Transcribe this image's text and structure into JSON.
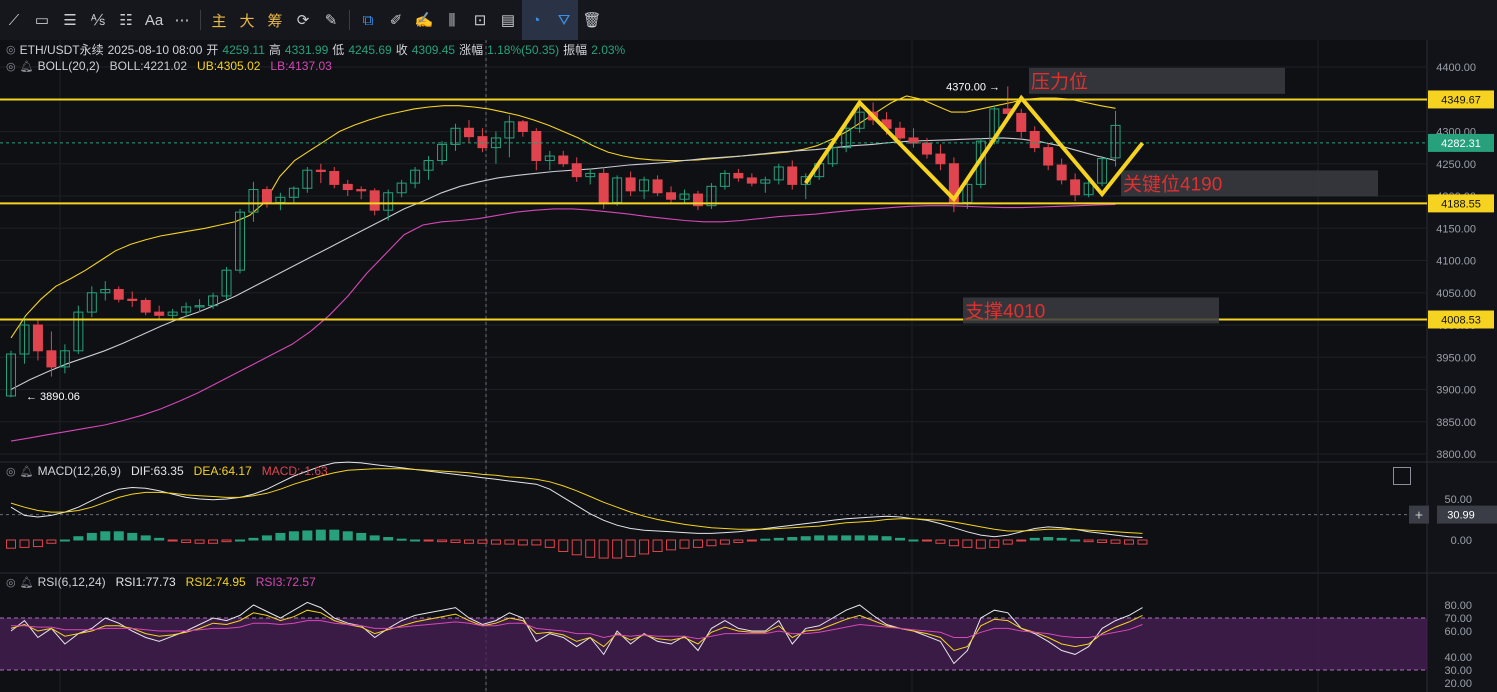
{
  "toolbar": {
    "items": [
      {
        "name": "line-tool-icon",
        "glyph": "⟋"
      },
      {
        "name": "rectangle-tool-icon",
        "glyph": "▭"
      },
      {
        "name": "parallel-lines-icon",
        "glyph": "☰"
      },
      {
        "name": "fib-tool-icon",
        "glyph": "⅍"
      },
      {
        "name": "fib-levels-icon",
        "glyph": "☷"
      },
      {
        "name": "text-tool-icon",
        "glyph": "Aa"
      },
      {
        "name": "more-icon",
        "glyph": "⋯"
      }
    ],
    "cn_items": [
      "主",
      "大",
      "筹"
    ],
    "tools2": [
      {
        "name": "replay-icon",
        "glyph": "⟳"
      },
      {
        "name": "draw-icon",
        "glyph": "✎"
      }
    ],
    "tools3": [
      {
        "name": "copy-icon",
        "glyph": "⧉",
        "blue": true
      },
      {
        "name": "ruler-icon",
        "glyph": "✐"
      },
      {
        "name": "brush-icon",
        "glyph": "✍"
      },
      {
        "name": "candle-type-icon",
        "glyph": "⫼"
      },
      {
        "name": "lock-icon",
        "glyph": "⊡"
      },
      {
        "name": "template-icon",
        "glyph": "▤"
      },
      {
        "name": "magnet-icon",
        "glyph": "◔",
        "blue": true,
        "active": true
      },
      {
        "name": "filter-icon",
        "glyph": "⛛",
        "blue": true,
        "active": true
      },
      {
        "name": "trash-icon",
        "glyph": "🗑"
      }
    ]
  },
  "main_legend": {
    "symbol": "ETH/USDT永续",
    "datetime": "2025-08-10 08:00",
    "open_label": "开",
    "open": "4259.11",
    "high_label": "高",
    "high": "4331.99",
    "low_label": "低",
    "low": "4245.69",
    "close_label": "收",
    "close": "4309.45",
    "change_label": "涨幅",
    "change": "1.18%(50.35)",
    "amp_label": "振幅",
    "amp": "2.03%"
  },
  "boll_legend": {
    "name": "BOLL(20,2)",
    "boll": "BOLL:4221.02",
    "ub": "UB:4305.02",
    "lb": "LB:4137.03"
  },
  "macd_legend": {
    "name": "MACD(12,26,9)",
    "dif": "DIF:63.35",
    "dea": "DEA:64.17",
    "macd": "MACD:-1.63"
  },
  "rsi_legend": {
    "name": "RSI(6,12,24)",
    "rsi1": "RSI1:77.73",
    "rsi2": "RSI2:74.95",
    "rsi3": "RSI3:72.57"
  },
  "colors": {
    "up": "#26a17b",
    "down": "#e0444e",
    "mid": "#c9cbd1",
    "upper": "#f5d320",
    "lower": "#d548b6",
    "rsi1": "#e6e6ea",
    "rsi2": "#f5d320",
    "rsi3": "#d548b6",
    "level": "#f5d320"
  },
  "chart_data": {
    "type": "candlestick",
    "price_axis": {
      "min": 3800,
      "max": 4400,
      "ticks": [
        "3800.00",
        "3850.00",
        "3900.00",
        "3950.00",
        "4000.00",
        "4050.00",
        "4100.00",
        "4150.00",
        "4200.00",
        "4250.00",
        "4300.00",
        "4350.00",
        "4400.00"
      ]
    },
    "levels": [
      {
        "value": 4349.67,
        "label": "4349.67"
      },
      {
        "value": 4188.55,
        "label": "4188.55"
      },
      {
        "value": 4008.53,
        "label": "4008.53"
      }
    ],
    "current_price": {
      "value": 4282.31,
      "label": "4282.31"
    },
    "annotations": [
      {
        "text": "压力位",
        "price": 4377
      },
      {
        "text": "关键位4190",
        "price": 4218
      },
      {
        "text": "支撑4010",
        "price": 4021
      }
    ],
    "high_marker": {
      "value": 4370.0,
      "label": "4370.00 →"
    },
    "low_marker": {
      "value": 3890.06,
      "label": "← 3890.06"
    },
    "candles": [
      [
        3890,
        3960,
        3888,
        3955
      ],
      [
        3955,
        4012,
        3940,
        4000
      ],
      [
        4000,
        4008,
        3945,
        3960
      ],
      [
        3960,
        3990,
        3920,
        3935
      ],
      [
        3935,
        3970,
        3925,
        3960
      ],
      [
        3960,
        4030,
        3955,
        4020
      ],
      [
        4020,
        4060,
        4012,
        4050
      ],
      [
        4050,
        4068,
        4038,
        4055
      ],
      [
        4055,
        4060,
        4035,
        4040
      ],
      [
        4040,
        4052,
        4028,
        4038
      ],
      [
        4038,
        4042,
        4015,
        4020
      ],
      [
        4020,
        4030,
        4010,
        4015
      ],
      [
        4015,
        4025,
        4008,
        4020
      ],
      [
        4020,
        4035,
        4012,
        4028
      ],
      [
        4028,
        4040,
        4020,
        4030
      ],
      [
        4030,
        4050,
        4025,
        4045
      ],
      [
        4045,
        4090,
        4040,
        4085
      ],
      [
        4085,
        4180,
        4080,
        4175
      ],
      [
        4175,
        4222,
        4160,
        4210
      ],
      [
        4210,
        4215,
        4182,
        4190
      ],
      [
        4190,
        4205,
        4178,
        4198
      ],
      [
        4198,
        4215,
        4190,
        4212
      ],
      [
        4212,
        4245,
        4205,
        4240
      ],
      [
        4240,
        4250,
        4220,
        4238
      ],
      [
        4238,
        4245,
        4212,
        4218
      ],
      [
        4218,
        4225,
        4200,
        4210
      ],
      [
        4210,
        4215,
        4195,
        4208
      ],
      [
        4208,
        4212,
        4170,
        4178
      ],
      [
        4178,
        4210,
        4162,
        4205
      ],
      [
        4205,
        4225,
        4198,
        4220
      ],
      [
        4220,
        4245,
        4212,
        4240
      ],
      [
        4240,
        4262,
        4225,
        4255
      ],
      [
        4255,
        4285,
        4248,
        4280
      ],
      [
        4280,
        4312,
        4270,
        4305
      ],
      [
        4305,
        4318,
        4282,
        4292
      ],
      [
        4292,
        4305,
        4268,
        4275
      ],
      [
        4275,
        4300,
        4250,
        4290
      ],
      [
        4290,
        4325,
        4260,
        4315
      ],
      [
        4315,
        4318,
        4292,
        4300
      ],
      [
        4300,
        4305,
        4240,
        4255
      ],
      [
        4255,
        4270,
        4240,
        4262
      ],
      [
        4262,
        4270,
        4245,
        4250
      ],
      [
        4250,
        4260,
        4222,
        4230
      ],
      [
        4230,
        4242,
        4218,
        4235
      ],
      [
        4235,
        4245,
        4180,
        4190
      ],
      [
        4190,
        4232,
        4185,
        4228
      ],
      [
        4228,
        4238,
        4200,
        4208
      ],
      [
        4208,
        4230,
        4195,
        4225
      ],
      [
        4225,
        4232,
        4200,
        4205
      ],
      [
        4205,
        4215,
        4188,
        4195
      ],
      [
        4195,
        4210,
        4190,
        4203
      ],
      [
        4203,
        4208,
        4178,
        4185
      ],
      [
        4185,
        4220,
        4180,
        4215
      ],
      [
        4215,
        4240,
        4210,
        4235
      ],
      [
        4235,
        4242,
        4222,
        4228
      ],
      [
        4228,
        4235,
        4215,
        4220
      ],
      [
        4220,
        4230,
        4205,
        4225
      ],
      [
        4225,
        4250,
        4218,
        4245
      ],
      [
        4245,
        4255,
        4210,
        4218
      ],
      [
        4218,
        4235,
        4195,
        4230
      ],
      [
        4230,
        4255,
        4225,
        4250
      ],
      [
        4250,
        4282,
        4245,
        4275
      ],
      [
        4275,
        4312,
        4268,
        4305
      ],
      [
        4305,
        4340,
        4298,
        4330
      ],
      [
        4330,
        4345,
        4310,
        4318
      ],
      [
        4318,
        4330,
        4295,
        4305
      ],
      [
        4305,
        4315,
        4280,
        4290
      ],
      [
        4290,
        4305,
        4275,
        4282
      ],
      [
        4282,
        4290,
        4258,
        4265
      ],
      [
        4265,
        4280,
        4240,
        4250
      ],
      [
        4250,
        4260,
        4175,
        4190
      ],
      [
        4190,
        4225,
        4180,
        4218
      ],
      [
        4218,
        4290,
        4212,
        4285
      ],
      [
        4285,
        4340,
        4280,
        4335
      ],
      [
        4335,
        4370,
        4320,
        4328
      ],
      [
        4328,
        4335,
        4290,
        4300
      ],
      [
        4300,
        4308,
        4268,
        4275
      ],
      [
        4275,
        4282,
        4240,
        4248
      ],
      [
        4248,
        4258,
        4218,
        4225
      ],
      [
        4225,
        4235,
        4192,
        4202
      ],
      [
        4202,
        4225,
        4198,
        4220
      ],
      [
        4220,
        4262,
        4215,
        4258
      ],
      [
        4259.11,
        4331.99,
        4245.69,
        4309.45
      ]
    ],
    "boll_upper": [
      3980,
      4015,
      4040,
      4060,
      4072,
      4085,
      4100,
      4115,
      4125,
      4132,
      4138,
      4142,
      4146,
      4150,
      4155,
      4160,
      4170,
      4190,
      4230,
      4255,
      4270,
      4285,
      4300,
      4310,
      4318,
      4325,
      4330,
      4335,
      4338,
      4340,
      4340,
      4338,
      4335,
      4330,
      4325,
      4318,
      4310,
      4300,
      4290,
      4278,
      4268,
      4262,
      4258,
      4256,
      4255,
      4255,
      4256,
      4258,
      4260,
      4262,
      4264,
      4266,
      4268,
      4272,
      4278,
      4288,
      4300,
      4315,
      4330,
      4345,
      4355,
      4350,
      4340,
      4330,
      4330,
      4335,
      4340,
      4345,
      4350,
      4352,
      4352,
      4350,
      4345,
      4340,
      4336
    ],
    "boll_mid": [
      3900,
      3915,
      3928,
      3940,
      3950,
      3960,
      3972,
      3985,
      3998,
      4010,
      4020,
      4032,
      4045,
      4060,
      4075,
      4090,
      4105,
      4120,
      4135,
      4150,
      4165,
      4180,
      4192,
      4205,
      4215,
      4222,
      4228,
      4232,
      4235,
      4238,
      4240,
      4242,
      4245,
      4248,
      4250,
      4252,
      4255,
      4258,
      4260,
      4262,
      4265,
      4268,
      4270,
      4272,
      4275,
      4278,
      4280,
      4283,
      4285,
      4286,
      4287,
      4288,
      4289,
      4290,
      4288,
      4284,
      4278,
      4270,
      4262,
      4255
    ],
    "boll_lower": [
      3820,
      3825,
      3830,
      3835,
      3840,
      3845,
      3852,
      3860,
      3870,
      3882,
      3895,
      3910,
      3925,
      3940,
      3955,
      3970,
      3990,
      4015,
      4045,
      4080,
      4110,
      4140,
      4155,
      4160,
      4162,
      4165,
      4170,
      4175,
      4178,
      4180,
      4180,
      4178,
      4175,
      4172,
      4168,
      4165,
      4162,
      4160,
      4160,
      4162,
      4165,
      4168,
      4170,
      4172,
      4175,
      4178,
      4180,
      4182,
      4184,
      4185,
      4185,
      4184,
      4183,
      4182,
      4182,
      4183,
      4184,
      4185,
      4186,
      4187
    ],
    "macd": {
      "axis_ticks": [
        "0.00",
        "50.00"
      ],
      "current": {
        "value": 30.99,
        "label": "30.99"
      },
      "dif": [
        40,
        30,
        28,
        30,
        34,
        40,
        48,
        56,
        62,
        64,
        63,
        60,
        56,
        52,
        50,
        49,
        50,
        52,
        56,
        62,
        70,
        78,
        84,
        90,
        94,
        95,
        94,
        92,
        90,
        88,
        86,
        84,
        82,
        80,
        78,
        76,
        74,
        72,
        70,
        68,
        62,
        52,
        42,
        32,
        24,
        18,
        14,
        12,
        11,
        10,
        9,
        8,
        8,
        9,
        10,
        12,
        14,
        16,
        18,
        20,
        22,
        24,
        26,
        27,
        28,
        29,
        28,
        26,
        24,
        20,
        15,
        10,
        6,
        4,
        6,
        10,
        14,
        16,
        15,
        13,
        10,
        8,
        6,
        4,
        3
      ],
      "dea": [
        45,
        40,
        36,
        34,
        34,
        36,
        40,
        46,
        52,
        56,
        58,
        58,
        57,
        55,
        54,
        53,
        52,
        52,
        54,
        57,
        62,
        68,
        73,
        78,
        82,
        85,
        86,
        87,
        87,
        87,
        86,
        85,
        84,
        83,
        82,
        80,
        79,
        77,
        76,
        74,
        71,
        66,
        60,
        53,
        46,
        40,
        34,
        29,
        25,
        22,
        19,
        17,
        15,
        14,
        13,
        13,
        13,
        14,
        15,
        16,
        17,
        19,
        21,
        22,
        23,
        25,
        26,
        26,
        25,
        24,
        22,
        19,
        16,
        13,
        11,
        11,
        12,
        13,
        13,
        13,
        12,
        11,
        10,
        9,
        8
      ],
      "hist": [
        -10,
        -9,
        -8,
        -4,
        0,
        4,
        8,
        10,
        10,
        8,
        5,
        2,
        -1,
        -3,
        -4,
        -4,
        -2,
        0,
        2,
        5,
        8,
        10,
        11,
        12,
        12,
        10,
        8,
        5,
        3,
        1,
        0,
        -1,
        -2,
        -3,
        -4,
        -4,
        -5,
        -5,
        -6,
        -6,
        -9,
        -14,
        -18,
        -21,
        -22,
        -22,
        -20,
        -17,
        -14,
        -12,
        -10,
        -9,
        -7,
        -5,
        -3,
        -1,
        1,
        2,
        3,
        4,
        5,
        5,
        5,
        5,
        5,
        4,
        2,
        0,
        -1,
        -4,
        -7,
        -9,
        -10,
        -9,
        -5,
        -1,
        2,
        3,
        2,
        0,
        -2,
        -3,
        -4,
        -5,
        -5
      ]
    },
    "rsi": {
      "axis_ticks": [
        "20.00",
        "30.00",
        "40.00",
        "60.00",
        "70.00",
        "80.00"
      ],
      "overbought": 70,
      "oversold": 30,
      "rsi1": [
        60,
        68,
        55,
        62,
        50,
        58,
        62,
        70,
        66,
        60,
        55,
        52,
        56,
        60,
        65,
        70,
        68,
        72,
        80,
        75,
        70,
        76,
        82,
        78,
        70,
        66,
        64,
        55,
        62,
        68,
        72,
        74,
        76,
        78,
        70,
        65,
        68,
        74,
        70,
        52,
        58,
        55,
        48,
        55,
        42,
        60,
        50,
        58,
        52,
        50,
        56,
        45,
        62,
        68,
        62,
        60,
        60,
        68,
        50,
        62,
        64,
        70,
        76,
        80,
        72,
        65,
        62,
        60,
        56,
        52,
        35,
        45,
        70,
        76,
        74,
        62,
        58,
        52,
        45,
        42,
        48,
        62,
        68,
        72,
        78
      ],
      "rsi2": [
        62,
        65,
        60,
        62,
        56,
        58,
        60,
        64,
        64,
        62,
        58,
        56,
        57,
        59,
        62,
        66,
        65,
        68,
        74,
        72,
        68,
        71,
        76,
        74,
        68,
        65,
        63,
        58,
        61,
        64,
        67,
        69,
        71,
        73,
        68,
        64,
        66,
        70,
        68,
        58,
        59,
        57,
        52,
        55,
        48,
        58,
        53,
        57,
        54,
        53,
        55,
        50,
        59,
        63,
        60,
        59,
        59,
        64,
        55,
        60,
        61,
        65,
        69,
        72,
        68,
        64,
        62,
        60,
        58,
        55,
        45,
        48,
        64,
        69,
        68,
        62,
        59,
        55,
        50,
        48,
        50,
        58,
        63,
        67,
        72
      ],
      "rsi3": [
        64,
        64,
        63,
        63,
        61,
        61,
        61,
        62,
        62,
        62,
        61,
        60,
        60,
        60,
        61,
        62,
        62,
        63,
        66,
        66,
        65,
        66,
        68,
        68,
        66,
        65,
        64,
        62,
        62,
        63,
        64,
        65,
        66,
        67,
        66,
        64,
        64,
        66,
        66,
        62,
        61,
        60,
        58,
        58,
        55,
        57,
        56,
        57,
        56,
        56,
        56,
        54,
        56,
        58,
        58,
        58,
        58,
        60,
        58,
        58,
        59,
        61,
        63,
        65,
        64,
        63,
        62,
        61,
        60,
        59,
        55,
        55,
        59,
        62,
        62,
        60,
        59,
        58,
        56,
        55,
        55,
        57,
        59,
        61,
        65
      ]
    },
    "zigzag": [
      {
        "i": 59,
        "p": 4220
      },
      {
        "i": 63,
        "p": 4345
      },
      {
        "i": 70,
        "p": 4195
      },
      {
        "i": 75,
        "p": 4352
      },
      {
        "i": 81,
        "p": 4203
      },
      {
        "i": 84,
        "p": 4282
      }
    ]
  }
}
